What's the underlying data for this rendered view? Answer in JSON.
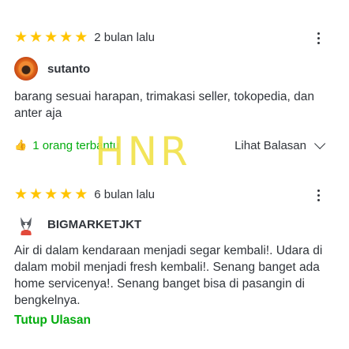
{
  "reviews": [
    {
      "rating": 5,
      "time_ago": "2 bulan lalu",
      "username": "sutanto",
      "text": "barang sesuai harapan, trimakasi seller, tokopedia, dan anter aja",
      "helpful_text": "1 orang terbantu",
      "replies_label": "Lihat Balasan"
    },
    {
      "rating": 5,
      "time_ago": "6 bulan lalu",
      "username": "BIGMARKETJKT",
      "text": "Air di dalam kendaraan menjadi segar kembali!. Udara di dalam mobil menjadi fresh kembali!. Senang banget ada home servicenya!. Senang banget bisa di pasangin di bengkelnya.",
      "collapse_label": "Tutup Ulasan"
    }
  ],
  "watermark": "HNR",
  "colors": {
    "star": "#ffc400",
    "accent_green": "#03ac0e",
    "text": "#31353b",
    "watermark": "#f1e24b"
  },
  "icons": {
    "star": "star-icon",
    "more": "kebab-menu-icon",
    "helpful": "thumbs-up-icon",
    "expand": "chevron-down-icon"
  }
}
